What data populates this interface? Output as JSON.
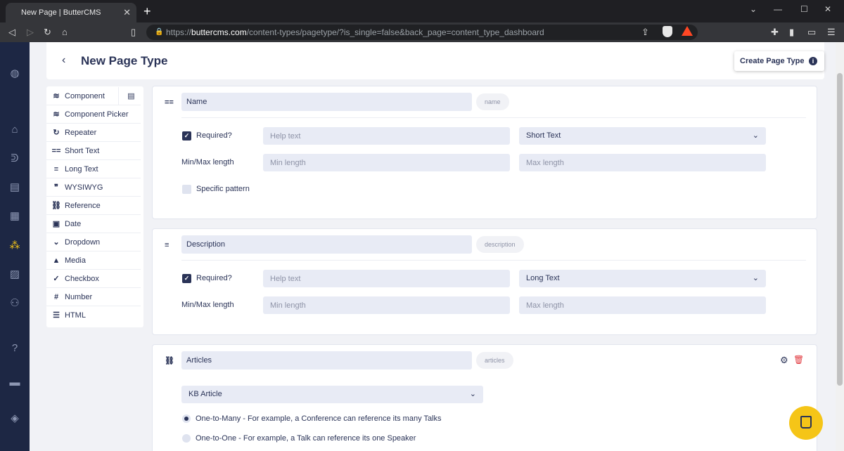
{
  "browser": {
    "tab_title": "New Page | ButterCMS",
    "tab_close": "✕",
    "new_tab": "+",
    "url_host": "buttercms.com",
    "url_scheme": "https://",
    "url_path": "/content-types/pagetype/?is_single=false&back_page=content_type_dashboard"
  },
  "header": {
    "back": "‹",
    "title": "New Page Type",
    "create_button": "Create Page Type",
    "info": "i"
  },
  "palette": {
    "items": [
      {
        "label": "Component",
        "icon": "≋"
      },
      {
        "label": "Component Picker",
        "icon": "≋"
      },
      {
        "label": "Repeater",
        "icon": "↻"
      },
      {
        "label": "Short Text",
        "icon": "=="
      },
      {
        "label": "Long Text",
        "icon": "≡"
      },
      {
        "label": "WYSIWYG",
        "icon": "❞"
      },
      {
        "label": "Reference",
        "icon": "⛓"
      },
      {
        "label": "Date",
        "icon": "▣"
      },
      {
        "label": "Dropdown",
        "icon": "⌄"
      },
      {
        "label": "Media",
        "icon": "▲"
      },
      {
        "label": "Checkbox",
        "icon": "✓"
      },
      {
        "label": "Number",
        "icon": "#"
      },
      {
        "label": "HTML",
        "icon": "☰"
      }
    ],
    "library_icon": "▤"
  },
  "fields": {
    "name": {
      "handle_icon": "==",
      "value": "Name",
      "key": "name",
      "required_label": "Required?",
      "help_placeholder": "Help text",
      "type": "Short Text",
      "minmax_label": "Min/Max length",
      "min_placeholder": "Min length",
      "max_placeholder": "Max length",
      "pattern_label": "Specific pattern"
    },
    "description": {
      "handle_icon": "≡",
      "value": "Description",
      "key": "description",
      "required_label": "Required?",
      "help_placeholder": "Help text",
      "type": "Long Text",
      "minmax_label": "Min/Max length",
      "min_placeholder": "Min length",
      "max_placeholder": "Max length"
    },
    "articles": {
      "handle_icon": "⛓",
      "value": "Articles",
      "key": "articles",
      "reference_type": "KB Article",
      "option_many": "One-to-Many - For example, a Conference can reference its many Talks",
      "option_one": "One-to-One - For example, a Talk can reference its one Speaker"
    }
  },
  "icons": {
    "chevron": "⌄",
    "check": "✓",
    "gear": "⚙",
    "trash": "🗑"
  },
  "colors": {
    "accent": "#2a3357",
    "sidebar": "#1d2744",
    "brand_yellow": "#f5c518",
    "danger": "#e0363c"
  }
}
